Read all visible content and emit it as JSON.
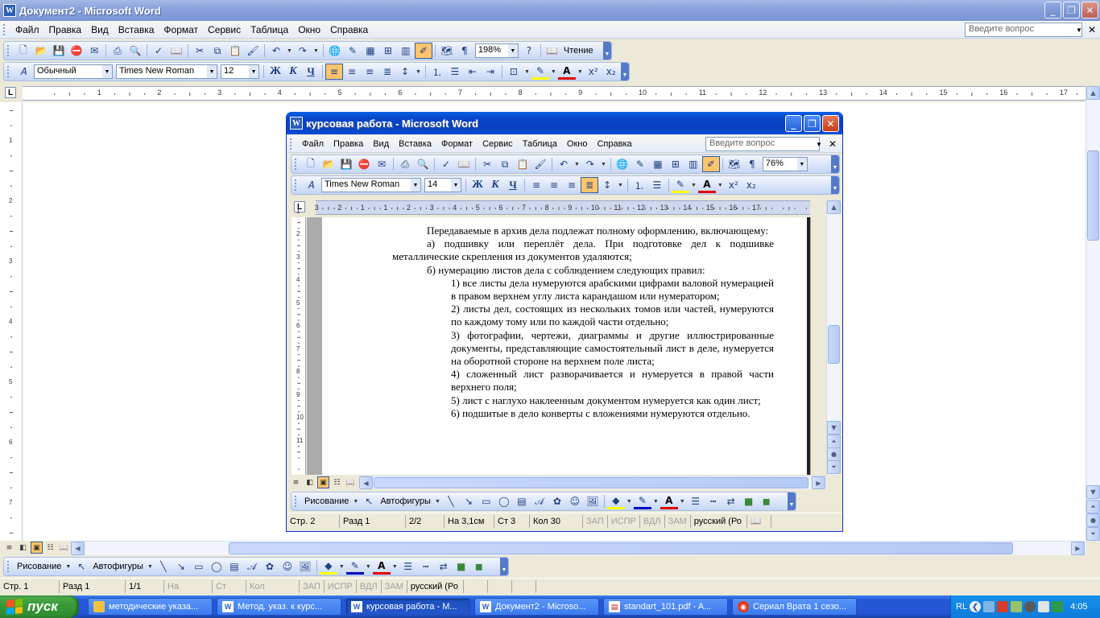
{
  "outer": {
    "title": "Документ2 - Microsoft Word",
    "menu": [
      "Файл",
      "Правка",
      "Вид",
      "Вставка",
      "Формат",
      "Сервис",
      "Таблица",
      "Окно",
      "Справка"
    ],
    "ask_placeholder": "Введите вопрос",
    "zoom": "198%",
    "reading_label": "Чтение",
    "style": "Обычный",
    "font": "Times New Roman",
    "size": "12",
    "ruler_numbers": [
      "1",
      "2",
      "3",
      "4",
      "5",
      "6",
      "7",
      "8",
      "9",
      "10",
      "11",
      "12",
      "13",
      "14",
      "15",
      "16",
      "17"
    ],
    "vruler_numbers": [
      "1",
      "2",
      "3",
      "4",
      "5",
      "6",
      "7",
      "8"
    ],
    "draw_label": "Рисование",
    "autoshapes_label": "Автофигуры",
    "status": {
      "page": "Стр.  1",
      "section": "Разд  1",
      "pages": "1/1",
      "at": "На",
      "line": "Ст",
      "col": "Кол",
      "rec": "ЗАП",
      "trk": "ИСПР",
      "ext": "ВДЛ",
      "ovr": "ЗАМ",
      "lang": "русский (Ро"
    }
  },
  "inner": {
    "title": "курсовая работа - Microsoft Word",
    "menu": [
      "Файл",
      "Правка",
      "Вид",
      "Вставка",
      "Формат",
      "Сервис",
      "Таблица",
      "Окно",
      "Справка"
    ],
    "ask_placeholder": "Введите вопрос",
    "zoom": "76%",
    "font": "Times New Roman",
    "size": "14",
    "ruler_numbers": [
      "3",
      "2",
      "1",
      "1",
      "2",
      "3",
      "4",
      "5",
      "6",
      "7",
      "8",
      "9",
      "10",
      "11",
      "12",
      "13",
      "14",
      "15",
      "16",
      "17"
    ],
    "vruler_numbers": [
      "1",
      "2",
      "3",
      "4",
      "5",
      "6",
      "7",
      "8",
      "9",
      "10",
      "11"
    ],
    "draw_label": "Рисование",
    "autoshapes_label": "Автофигуры",
    "doc": {
      "p1": "Передаваемые в архив дела подлежат полному оформлению, включающему:",
      "p2": "а) подшивку или переплёт дела. При подготовке дел к подшивке металлические скрепления из документов удаляются;",
      "p3": "б) нумерацию листов дела с соблюдением следующих правил:",
      "r1": "1) все листы дела нумеруются арабскими цифрами валовой нумерацией в правом верхнем углу листа карандашом или нумератором;",
      "r2": "2) листы дел, состоящих из нескольких томов или частей, нумеруются по каждому тому или по каждой части отдельно;",
      "r3": "3) фотографии, чертежи, диаграммы и другие иллюстрированные документы, представляющие самостоятельный лист в деле, нумеруется на оборотной стороне на верхнем поле листа;",
      "r4": "4) сложенный лист разворачивается и нумеруется в правой  части верхнего поля;",
      "r5": "5) лист с наглухо наклеенным документом нумеруется как один лист;",
      "r6": "6) подшитые в дело конверты с вложениями нумеруются отдельно."
    },
    "status": {
      "page": "Стр.  2",
      "section": "Разд  1",
      "pages": "2/2",
      "at": "На 3,1см",
      "line": "Ст  3",
      "col": "Кол  30",
      "rec": "ЗАП",
      "trk": "ИСПР",
      "ext": "ВДЛ",
      "ovr": "ЗАМ",
      "lang": "русский (Ро"
    }
  },
  "taskbar": {
    "start": "пуск",
    "tasks": [
      {
        "label": "методические указа...",
        "icon": "folder-icon"
      },
      {
        "label": "Метод. указ. к курс...",
        "icon": "word-icon"
      },
      {
        "label": "курсовая работа - М...",
        "icon": "word-icon",
        "active": true
      },
      {
        "label": "Документ2 - Microso...",
        "icon": "word-icon"
      },
      {
        "label": "standart_101.pdf - A...",
        "icon": "pdf-icon"
      },
      {
        "label": "Сериал Врата 1 сезо...",
        "icon": "browser-icon"
      }
    ],
    "lang": "RL",
    "clock": "4:05"
  },
  "colors": {
    "xp_blue": "#0846c9",
    "inactive_title": "#8aa3dc",
    "toolbar": "#c5d6f5",
    "highlight": "#ffc56b",
    "start_green": "#3a9a3a"
  }
}
